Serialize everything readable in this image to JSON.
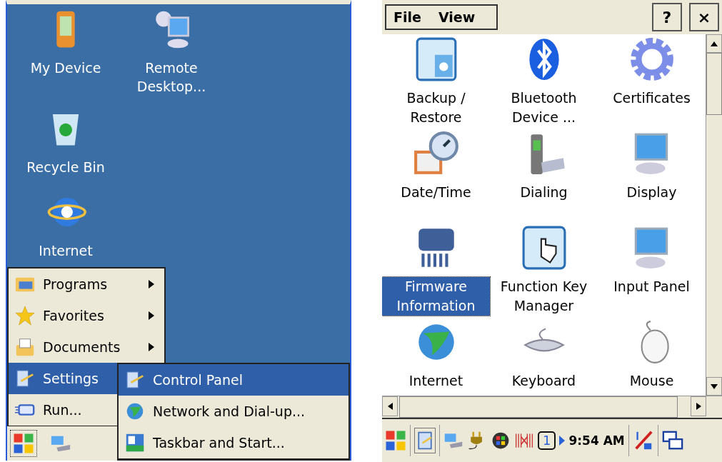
{
  "desktop": {
    "icons": [
      {
        "label": "My Device"
      },
      {
        "label": "Remote Desktop..."
      },
      {
        "label": "Recycle Bin"
      },
      {
        "label": "Internet"
      }
    ]
  },
  "start_menu": {
    "items": [
      {
        "label": "Programs",
        "has_submenu": true,
        "selected": false
      },
      {
        "label": "Favorites",
        "has_submenu": true,
        "selected": false
      },
      {
        "label": "Documents",
        "has_submenu": true,
        "selected": false
      },
      {
        "label": "Settings",
        "selected": true
      },
      {
        "label": "Run...",
        "selected": false
      }
    ]
  },
  "settings_submenu": {
    "items": [
      {
        "label": "Control Panel",
        "selected": true
      },
      {
        "label": "Network and Dial-up...",
        "selected": false
      },
      {
        "label": "Taskbar and Start...",
        "selected": false
      }
    ]
  },
  "control_panel": {
    "menu": [
      {
        "label": "File"
      },
      {
        "label": "View"
      }
    ],
    "help_button": "?",
    "close_button": "×",
    "items": [
      {
        "label": "Backup / Restore",
        "selected": false
      },
      {
        "label": "Bluetooth Device ...",
        "selected": false
      },
      {
        "label": "Certificates",
        "selected": false
      },
      {
        "label": "Date/Time",
        "selected": false
      },
      {
        "label": "Dialing",
        "selected": false
      },
      {
        "label": "Display",
        "selected": false
      },
      {
        "label": "Firmware Information",
        "selected": true
      },
      {
        "label": "Function Key Manager",
        "selected": false
      },
      {
        "label": "Input Panel",
        "selected": false
      },
      {
        "label": "Internet",
        "selected": false
      },
      {
        "label": "Keyboard",
        "selected": false
      },
      {
        "label": "Mouse",
        "selected": false
      }
    ]
  },
  "taskbar": {
    "input_indicator": "1",
    "time": "9:54 AM"
  }
}
